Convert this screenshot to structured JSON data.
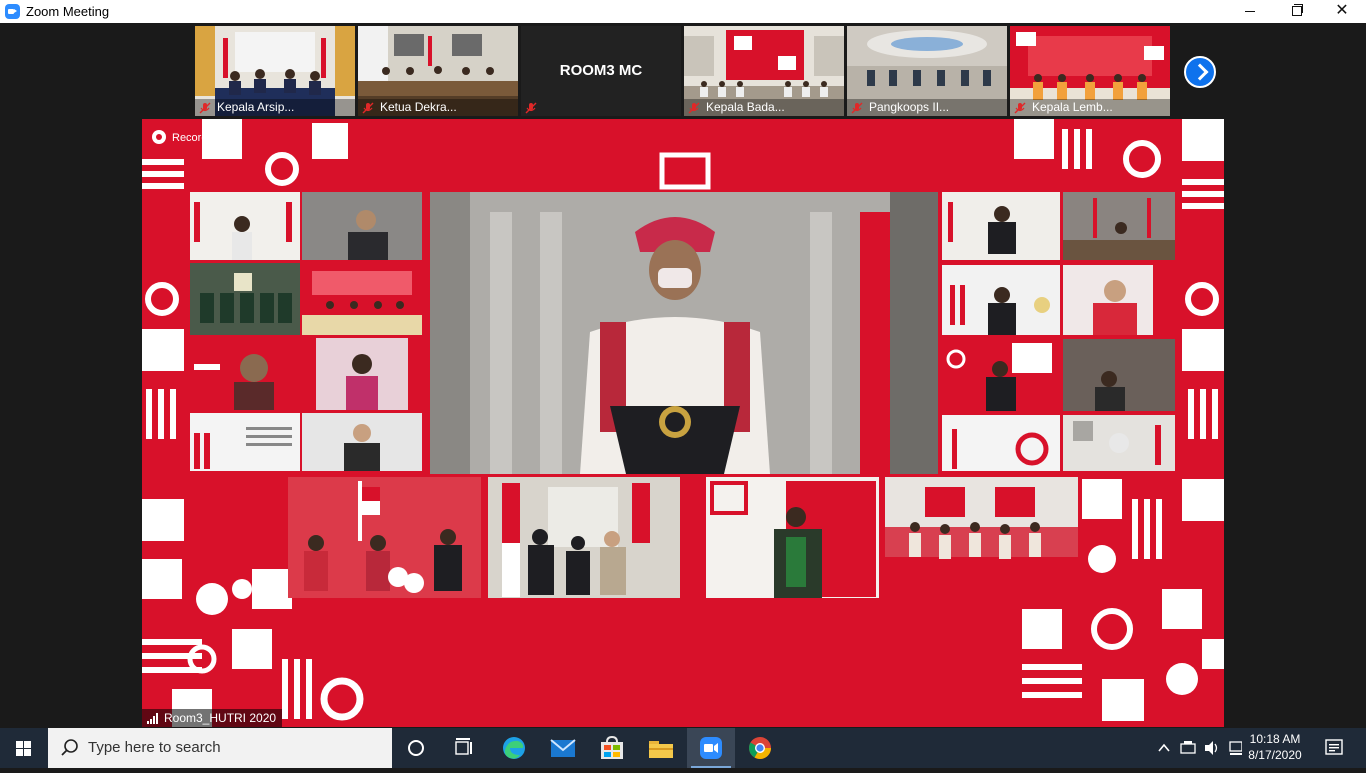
{
  "window": {
    "title": "Zoom Meeting"
  },
  "thumbnails": [
    {
      "label": "Kepala Arsip...",
      "scene": "arsip"
    },
    {
      "label": "Ketua Dekra...",
      "scene": "dekra"
    },
    {
      "label": "",
      "name": "ROOM3 MC",
      "scene": "mc"
    },
    {
      "label": "Kepala Bada...",
      "scene": "badan"
    },
    {
      "label": "Pangkoops II...",
      "scene": "pangkoops"
    },
    {
      "label": "Kepala Lemb...",
      "scene": "lemb"
    }
  ],
  "main": {
    "recording_label": "Recording...",
    "participant_name": "Room3_HUTRI 2020"
  },
  "taskbar": {
    "search_placeholder": "Type here to search",
    "time": "10:18 AM",
    "date": "8/17/2020"
  },
  "colors": {
    "broadcast_red": "#d8112a",
    "zoom_blue": "#0e72ed",
    "taskbar": "#1f2a38"
  }
}
